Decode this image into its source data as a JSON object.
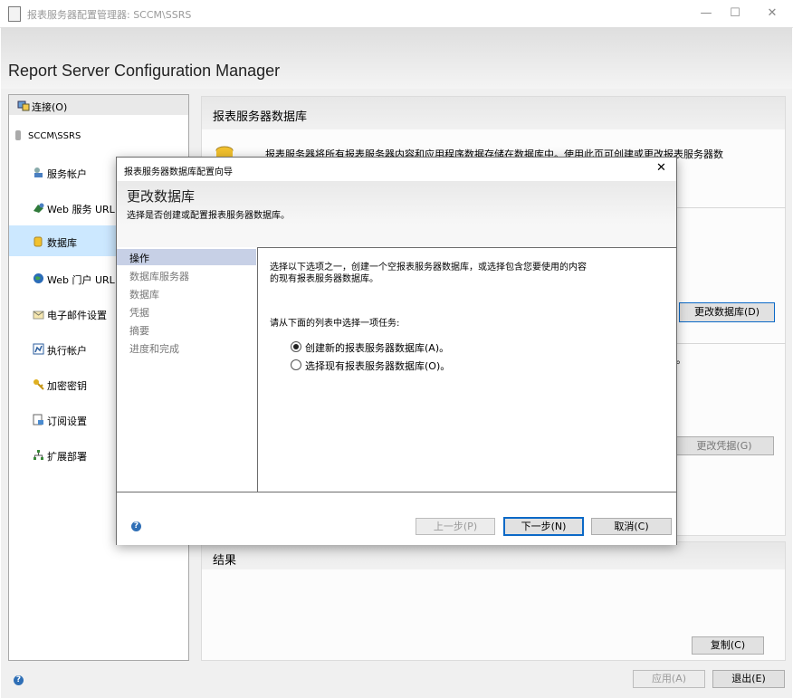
{
  "window": {
    "title": "报表服务器配置管理器: SCCM\\SSRS",
    "controls": {
      "minimize": "—",
      "maximize": "☐",
      "close": "✕"
    },
    "app_title": "Report Server Configuration Manager"
  },
  "sidebar": {
    "connect_label": "连接(O)",
    "server": "SCCM\\SSRS",
    "items": [
      {
        "label": "服务帐户",
        "icon": "service-account-icon"
      },
      {
        "label": "Web 服务 URL",
        "icon": "web-service-icon"
      },
      {
        "label": "数据库",
        "icon": "database-icon"
      },
      {
        "label": "Web 门户 URL",
        "icon": "globe-icon"
      },
      {
        "label": "电子邮件设置",
        "icon": "email-icon"
      },
      {
        "label": "执行帐户",
        "icon": "execution-account-icon"
      },
      {
        "label": "加密密钥",
        "icon": "key-icon"
      },
      {
        "label": "订阅设置",
        "icon": "subscription-icon"
      },
      {
        "label": "扩展部署",
        "icon": "scale-out-icon"
      }
    ]
  },
  "panel": {
    "title": "报表服务器数据库",
    "description": "报表服务器将所有报表服务器内容和应用程序数据存储在数据库中。使用此页可创建或更改报表服务器数",
    "change_db_button": "更改数据库(D)",
    "trailing_text": "。",
    "change_credentials_button": "更改凭据(G)"
  },
  "results": {
    "title": "结果",
    "copy_button": "复制(C)"
  },
  "footer": {
    "apply_button": "应用(A)",
    "exit_button": "退出(E)"
  },
  "dialog": {
    "title": "报表服务器数据库配置向导",
    "close": "✕",
    "heading": "更改数据库",
    "subheading": "选择是否创建或配置报表服务器数据库。",
    "steps": [
      {
        "label": "操作",
        "active": true
      },
      {
        "label": "数据库服务器",
        "active": false
      },
      {
        "label": "数据库",
        "active": false
      },
      {
        "label": "凭据",
        "active": false
      },
      {
        "label": "摘要",
        "active": false
      },
      {
        "label": "进度和完成",
        "active": false
      }
    ],
    "intro_line1": "选择以下选项之一，创建一个空报表服务器数据库，或选择包含您要使用的内容",
    "intro_line2": "的现有报表服务器数据库。",
    "prompt": "请从下面的列表中选择一项任务:",
    "options": [
      {
        "label": "创建新的报表服务器数据库(A)。",
        "checked": true
      },
      {
        "label": "选择现有报表服务器数据库(O)。",
        "checked": false
      }
    ],
    "back_button": "上一步(P)",
    "next_button": "下一步(N)",
    "cancel_button": "取消(C)"
  },
  "colors": {
    "selection": "#cce8ff",
    "step_active": "#c7d0e6",
    "primary_border": "#0b69c7"
  }
}
